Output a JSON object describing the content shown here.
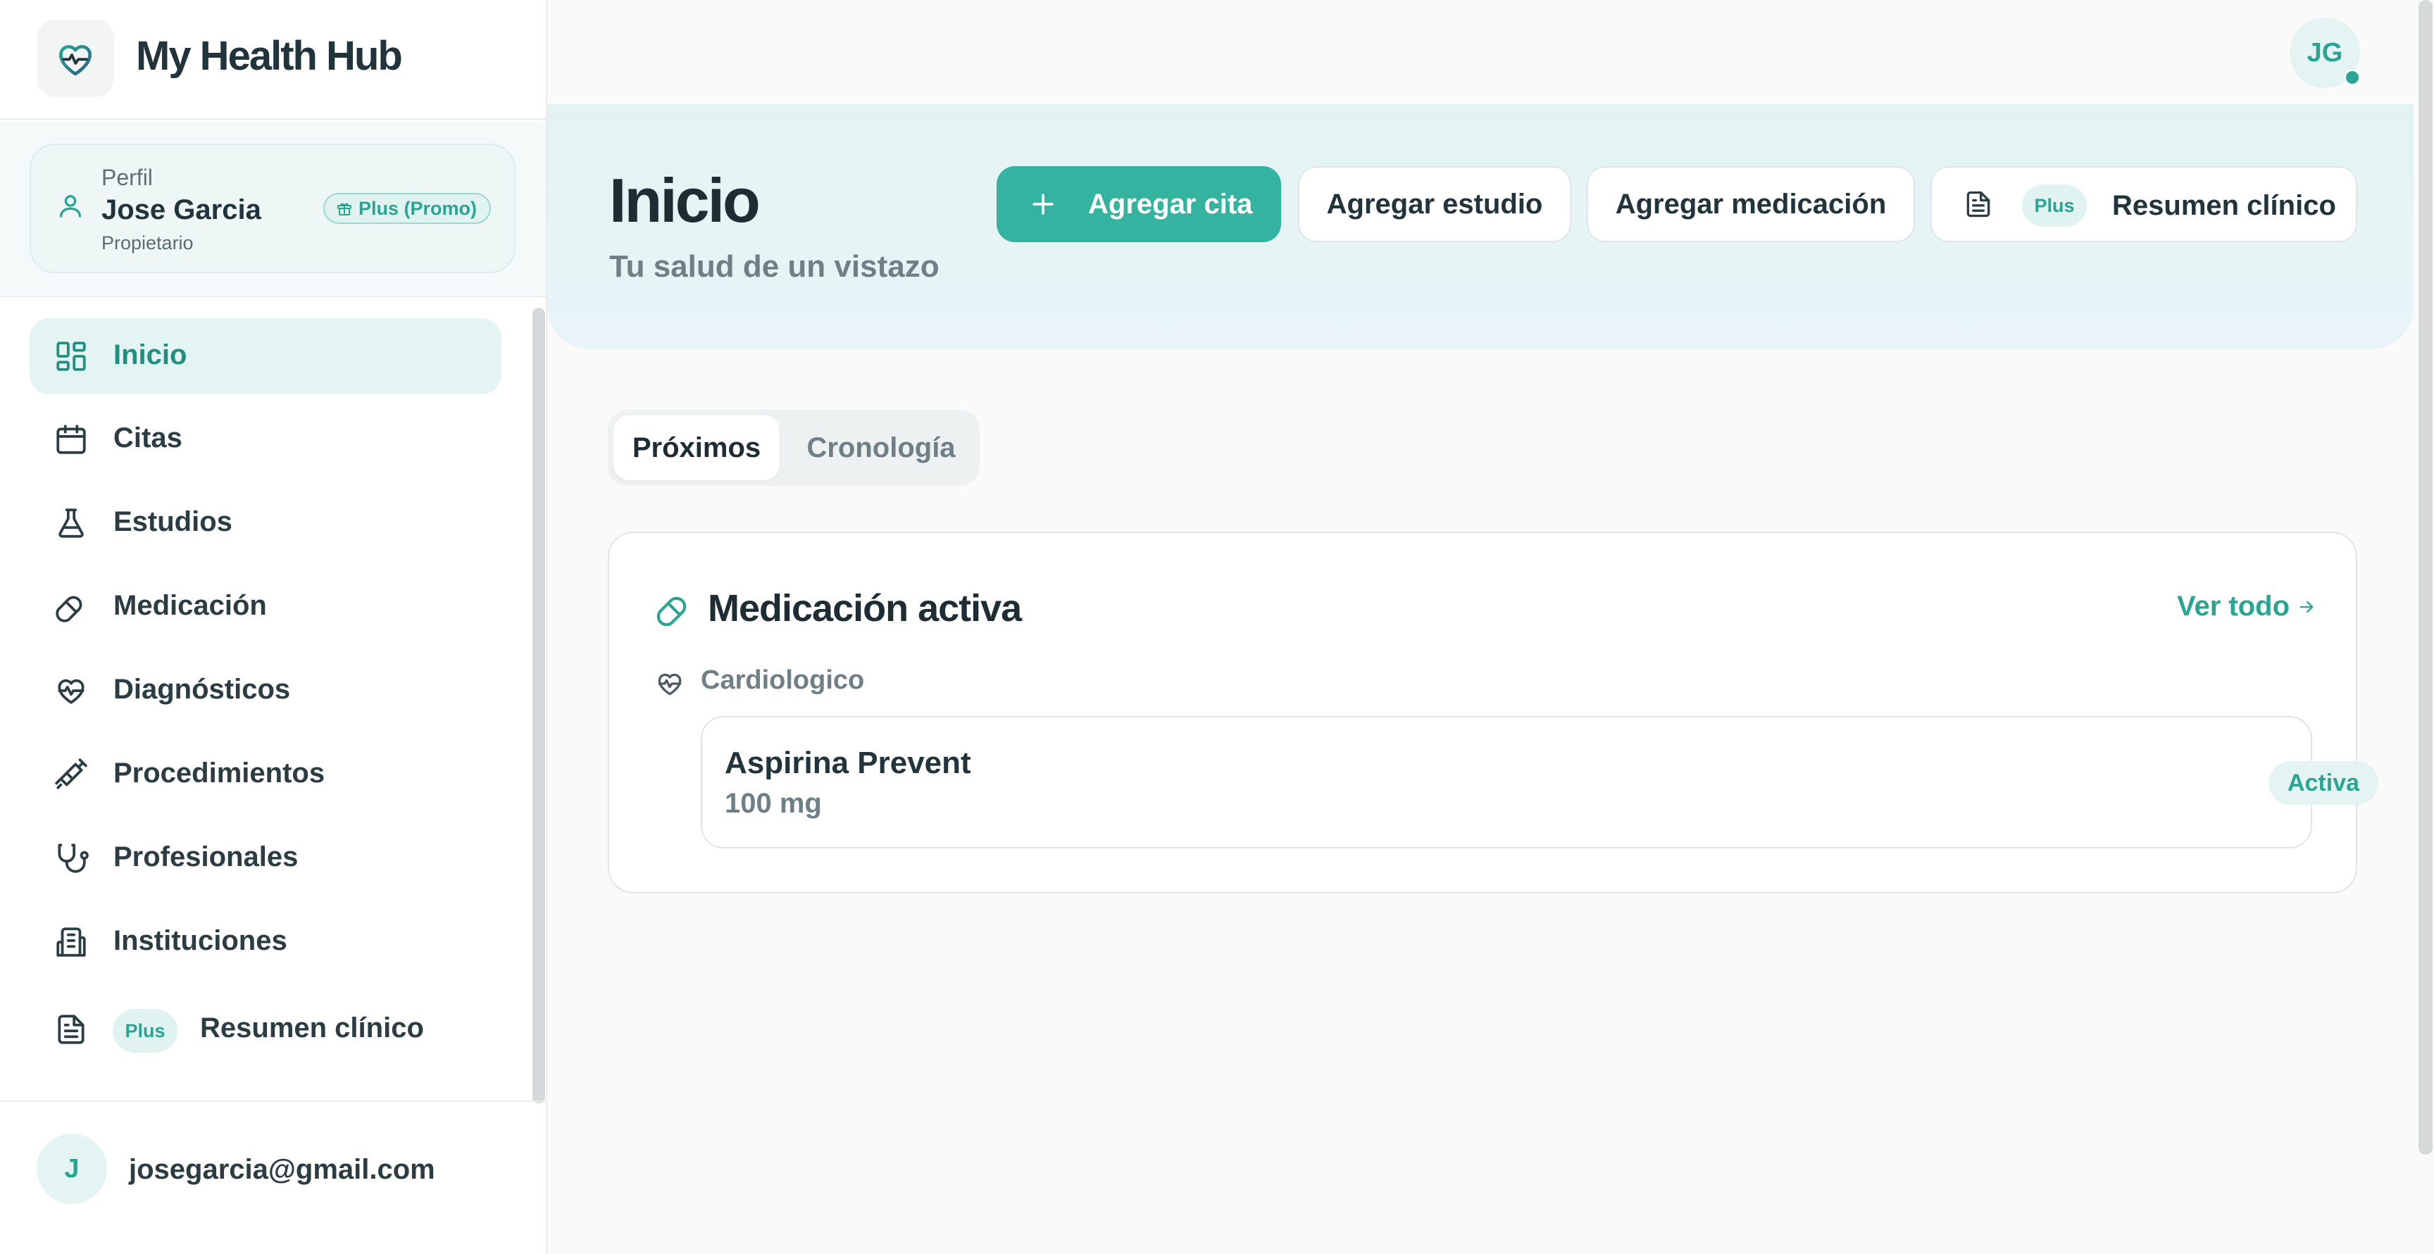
{
  "app": {
    "name": "My Health Hub"
  },
  "profile": {
    "section_label": "Perfil",
    "name": "Jose Garcia",
    "role": "Propietario",
    "badge": "Plus (Promo)"
  },
  "sidebar": {
    "items": [
      {
        "label": "Inicio",
        "icon": "dashboard-icon",
        "active": true
      },
      {
        "label": "Citas",
        "icon": "calendar-icon"
      },
      {
        "label": "Estudios",
        "icon": "flask-icon"
      },
      {
        "label": "Medicación",
        "icon": "pill-icon"
      },
      {
        "label": "Diagnósticos",
        "icon": "heart-pulse-icon"
      },
      {
        "label": "Procedimientos",
        "icon": "syringe-icon"
      },
      {
        "label": "Profesionales",
        "icon": "stethoscope-icon"
      },
      {
        "label": "Instituciones",
        "icon": "building-icon"
      },
      {
        "label": "Resumen clínico",
        "icon": "document-icon",
        "badge": "Plus"
      }
    ]
  },
  "account": {
    "initial": "J",
    "email": "josegarcia@gmail.com"
  },
  "header": {
    "user_initials": "JG"
  },
  "hero": {
    "title": "Inicio",
    "subtitle": "Tu salud de un vistazo",
    "actions": {
      "add_appointment": "Agregar cita",
      "add_study": "Agregar estudio",
      "add_medication": "Agregar medicación",
      "summary_badge": "Plus",
      "summary": "Resumen clínico"
    }
  },
  "tabs": [
    {
      "label": "Próximos",
      "active": true
    },
    {
      "label": "Cronología"
    }
  ],
  "active_medication": {
    "title": "Medicación activa",
    "view_all": "Ver todo",
    "group": "Cardiologico",
    "items": [
      {
        "name": "Aspirina Prevent",
        "dose": "100 mg",
        "status": "Activa"
      }
    ]
  },
  "colors": {
    "accent": "#33b3a0",
    "accent_text": "#2aa593",
    "accent_soft": "#e4f4f2",
    "text_dark": "#1e2d33",
    "text_muted": "#6e7f86"
  }
}
